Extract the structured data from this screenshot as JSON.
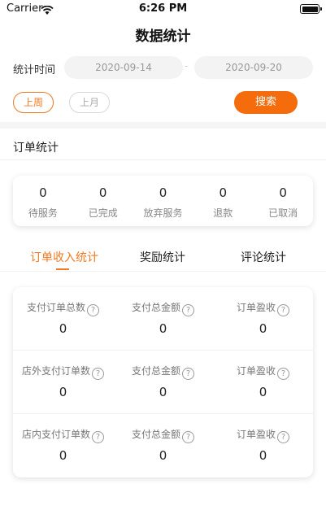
{
  "status_bar": {
    "carrier": "Carrier",
    "time": "6:26 PM"
  },
  "header": {
    "title": "数据统计"
  },
  "filter": {
    "time_label": "统计时间",
    "start_date": "2020-09-14",
    "end_date": "2020-09-20",
    "separator": "-",
    "last_week": "上周",
    "last_month": "上月",
    "search": "搜索"
  },
  "orders": {
    "title": "订单统计",
    "items": [
      {
        "value": "0",
        "label": "待服务"
      },
      {
        "value": "0",
        "label": "已完成"
      },
      {
        "value": "0",
        "label": "放弃服务"
      },
      {
        "value": "0",
        "label": "退款"
      },
      {
        "value": "0",
        "label": "已取消"
      }
    ]
  },
  "tabs": [
    {
      "label": "订单收入统计",
      "active": true
    },
    {
      "label": "奖励统计",
      "active": false
    },
    {
      "label": "评论统计",
      "active": false
    }
  ],
  "stats": {
    "help_glyph": "?",
    "rows": [
      [
        {
          "label": "支付订单总数",
          "value": "0"
        },
        {
          "label": "支付总金额",
          "value": "0"
        },
        {
          "label": "订单盈收",
          "value": "0"
        }
      ],
      [
        {
          "label": "店外支付订单数",
          "value": "0"
        },
        {
          "label": "支付总金额",
          "value": "0"
        },
        {
          "label": "订单盈收",
          "value": "0"
        }
      ],
      [
        {
          "label": "店内支付订单数",
          "value": "0"
        },
        {
          "label": "支付总金额",
          "value": "0"
        },
        {
          "label": "订单盈收",
          "value": "0"
        }
      ]
    ]
  },
  "colors": {
    "accent": "#f07a22",
    "search_button": "#f46c0c"
  }
}
